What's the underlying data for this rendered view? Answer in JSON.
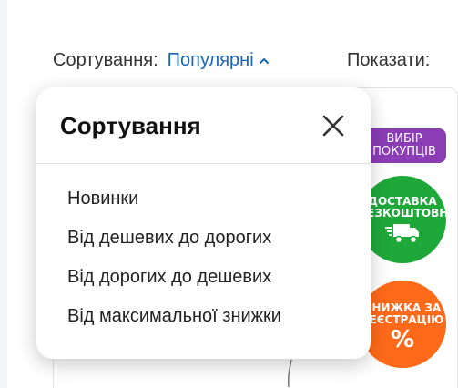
{
  "toolbar": {
    "sort_label": "Сортування:",
    "sort_value": "Популярні",
    "show_label": "Показати:"
  },
  "badges": {
    "choice": [
      "ВИБІР",
      "ПОКУПЦІВ"
    ],
    "delivery": [
      "ДОСТАВКА",
      "БЕЗКОШТОВНО"
    ],
    "discount": [
      "ЗНИЖКА ЗА",
      "РЕЄСТРАЦІЮ",
      "%"
    ]
  },
  "colors": {
    "accent": "#1a66b8",
    "choice_badge": "#8a3db5",
    "delivery_badge": "#1fa83a",
    "discount_badge": "#ff6a1a"
  },
  "sort_popup": {
    "title": "Сортування",
    "close_icon": "close-icon",
    "options": [
      "Новинки",
      "Від дешевих до дорогих",
      "Від дорогих до дешевих",
      "Від максимальної знижки"
    ]
  }
}
